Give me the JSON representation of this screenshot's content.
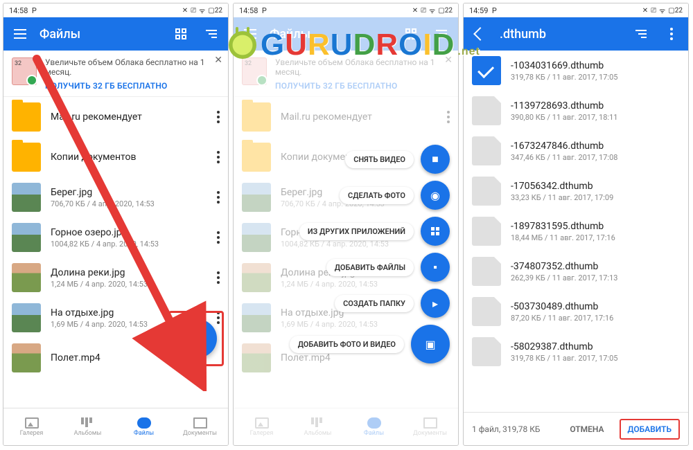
{
  "watermark": {
    "brand": "GURUDROID",
    "suffix": ".net"
  },
  "statusbar": {
    "time": "14:58",
    "apps": "P",
    "battery": "22"
  },
  "statusbar3": {
    "time": "14:59",
    "apps": "P",
    "battery": "22"
  },
  "panel1": {
    "appbar_title": "Файлы",
    "promo_title": "Увеличьте объем Облака бесплатно на 1 месяц.",
    "promo_cta": "ПОЛУЧИТЬ 32 ГБ БЕСПЛАТНО",
    "items": [
      {
        "name": "Mail.ru рекомендует",
        "meta": ""
      },
      {
        "name": "Копии документов",
        "meta": ""
      },
      {
        "name": "Берег.jpg",
        "meta": "706,70 КБ / 4 апр. 2020, 14:53"
      },
      {
        "name": "Горное озеро.jpg",
        "meta": "1004,82 КБ / 4 апр. 2020, 14:53"
      },
      {
        "name": "Долина реки.jpg",
        "meta": "1,24 МБ / 4 апр. 2020, 14:53"
      },
      {
        "name": "На отдыхе.jpg",
        "meta": "1,69 МБ / 4 апр. 2020, 14:53"
      },
      {
        "name": "Полет.mp4",
        "meta": ""
      }
    ],
    "nav": {
      "gallery": "Галерея",
      "albums": "Альбомы",
      "files": "Файлы",
      "docs": "Документы"
    }
  },
  "panel2": {
    "fab_options": [
      {
        "label": "СНЯТЬ ВИДЕО",
        "icon": "video"
      },
      {
        "label": "СДЕЛАТЬ ФОТО",
        "icon": "camera"
      },
      {
        "label": "ИЗ ДРУГИХ ПРИЛОЖЕНИЙ",
        "icon": "apps"
      },
      {
        "label": "ДОБАВИТЬ ФАЙЛЫ",
        "icon": "file"
      },
      {
        "label": "СОЗДАТЬ ПАПКУ",
        "icon": "folder"
      },
      {
        "label": "ДОБАВИТЬ ФОТО И ВИДЕО",
        "icon": "image"
      }
    ]
  },
  "panel3": {
    "appbar_title": ".dthumb",
    "items": [
      {
        "name": "-1034031669.dthumb",
        "meta": "319,78 КБ / 11 авг. 2017, 17:05",
        "selected": true
      },
      {
        "name": "-1139728693.dthumb",
        "meta": "390,80 КБ / 11 авг. 2017, 18:11"
      },
      {
        "name": "-1673247846.dthumb",
        "meta": "347,46 КБ / 11 авг. 2017, 17:08"
      },
      {
        "name": "-17056342.dthumb",
        "meta": "33,23 КБ / 11 авг. 2017, 17:09"
      },
      {
        "name": "-1897831595.dthumb",
        "meta": "18,44 МБ / 11 авг. 2017, 17:16"
      },
      {
        "name": "-374807352.dthumb",
        "meta": "262,39 КБ / 11 авг. 2017, 17:13"
      },
      {
        "name": "-503730489.dthumb",
        "meta": "87,20 КБ / 11 авг. 2017, 17:16"
      },
      {
        "name": "-58029387.dthumb",
        "meta": "319,78 КБ / 11 авг. 2017, 17:05"
      }
    ],
    "footer_info": "1 файл, 319,78 КБ",
    "cancel": "ОТМЕНА",
    "add": "ДОБАВИТЬ"
  }
}
